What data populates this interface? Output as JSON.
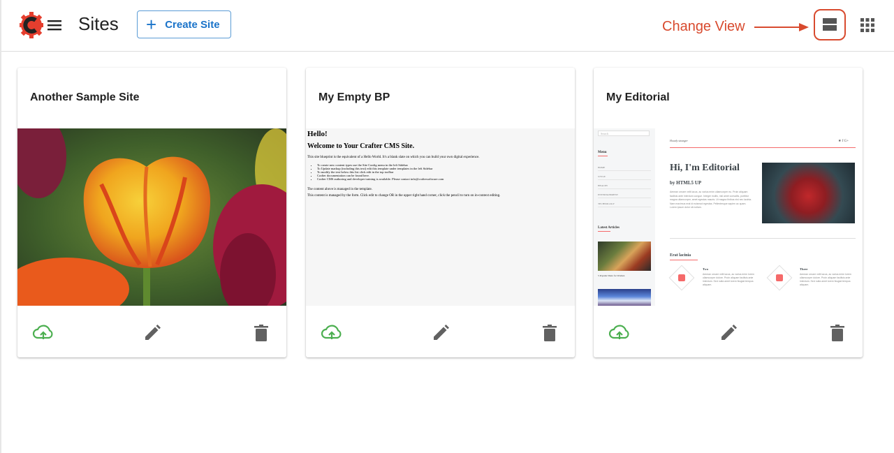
{
  "header": {
    "title": "Sites",
    "create_label": "Create Site",
    "change_view_label": "Change View"
  },
  "sites": [
    {
      "title": "Another Sample Site"
    },
    {
      "title": "My Empty BP"
    },
    {
      "title": "My Editorial"
    }
  ],
  "empty_bp_preview": {
    "hello": "Hello!",
    "welcome": "Welcome to Your Crafter CMS Site.",
    "intro": "This site blueprint is the equivalent of a Hello World. It's a blank slate on which you can build your own digital experience.",
    "bullets": [
      "To create new content types use the Site Config menu in the left Sidebar",
      "To Update markup (including this text) edit this template under templates in the left Sidebar",
      "To modify the text below this list click edit in the top toolbar",
      "Crafter documentation can be found here.",
      "Crafter CMS authoring and developer training is available. Please contact info@craftersoftware.com"
    ],
    "managed": "The content above is managed in the template.",
    "form_note": "This content is managed by the form. Click edit to change OR in the upper right hand corner, click the pencil to turn on in-context editing."
  },
  "editorial_preview": {
    "search": "Search",
    "menu_heading": "Menu",
    "menu_items": [
      "HOME",
      "STYLE",
      "HEALTH",
      "ENTERTAINMENT",
      "TECHNOLOGY"
    ],
    "latest_heading": "Latest Articles",
    "latest_caption": "5 Popular Diets for Women",
    "top_text": "Howdy stranger",
    "social": "★  f  G+",
    "hero_title": "Hi, I'm Editorial",
    "hero_sub": "by HTML5 UP",
    "hero_text": "Aenean ornare velit lacus, ac varius enim ullamcorper eu. Proin aliquam facilisis ante interdum congue. Integer mollis, nisl amet convallis, porttitor magna ullamcorper, amet egestas mauris. Ut magna finibus nisi nec lacinia. Nam maximus erat id euismod egestas. Pellentesque sapien ac quam. Lorem ipsum dolor sit nullam.",
    "section_title": "Erat lacinia",
    "features": [
      {
        "title": "Two",
        "text": "Aenean ornare velit lacus, ac varius enim lorem ullamcorper dolore. Proin aliquam facilisis ante interdum. Sed nulla amet lorem feugiat tempus aliquam."
      },
      {
        "title": "Three",
        "text": "Aenean ornare velit lacus, ac varius enim lorem ullamcorper dolore. Proin aliquam facilisis ante interdum. Sed nulla amet lorem feugiat tempus aliquam."
      }
    ]
  },
  "colors": {
    "accent_blue": "#1a73c9",
    "annotation_red": "#d84a2e",
    "publish_green": "#4caf50",
    "icon_gray": "#616161"
  },
  "icons": {
    "logo": "crafter-logo-icon",
    "menu": "hamburger-menu-icon",
    "view": "list-view-icon",
    "apps": "apps-grid-icon",
    "publish": "cloud-upload-icon",
    "edit": "pencil-icon",
    "delete": "trash-icon"
  }
}
